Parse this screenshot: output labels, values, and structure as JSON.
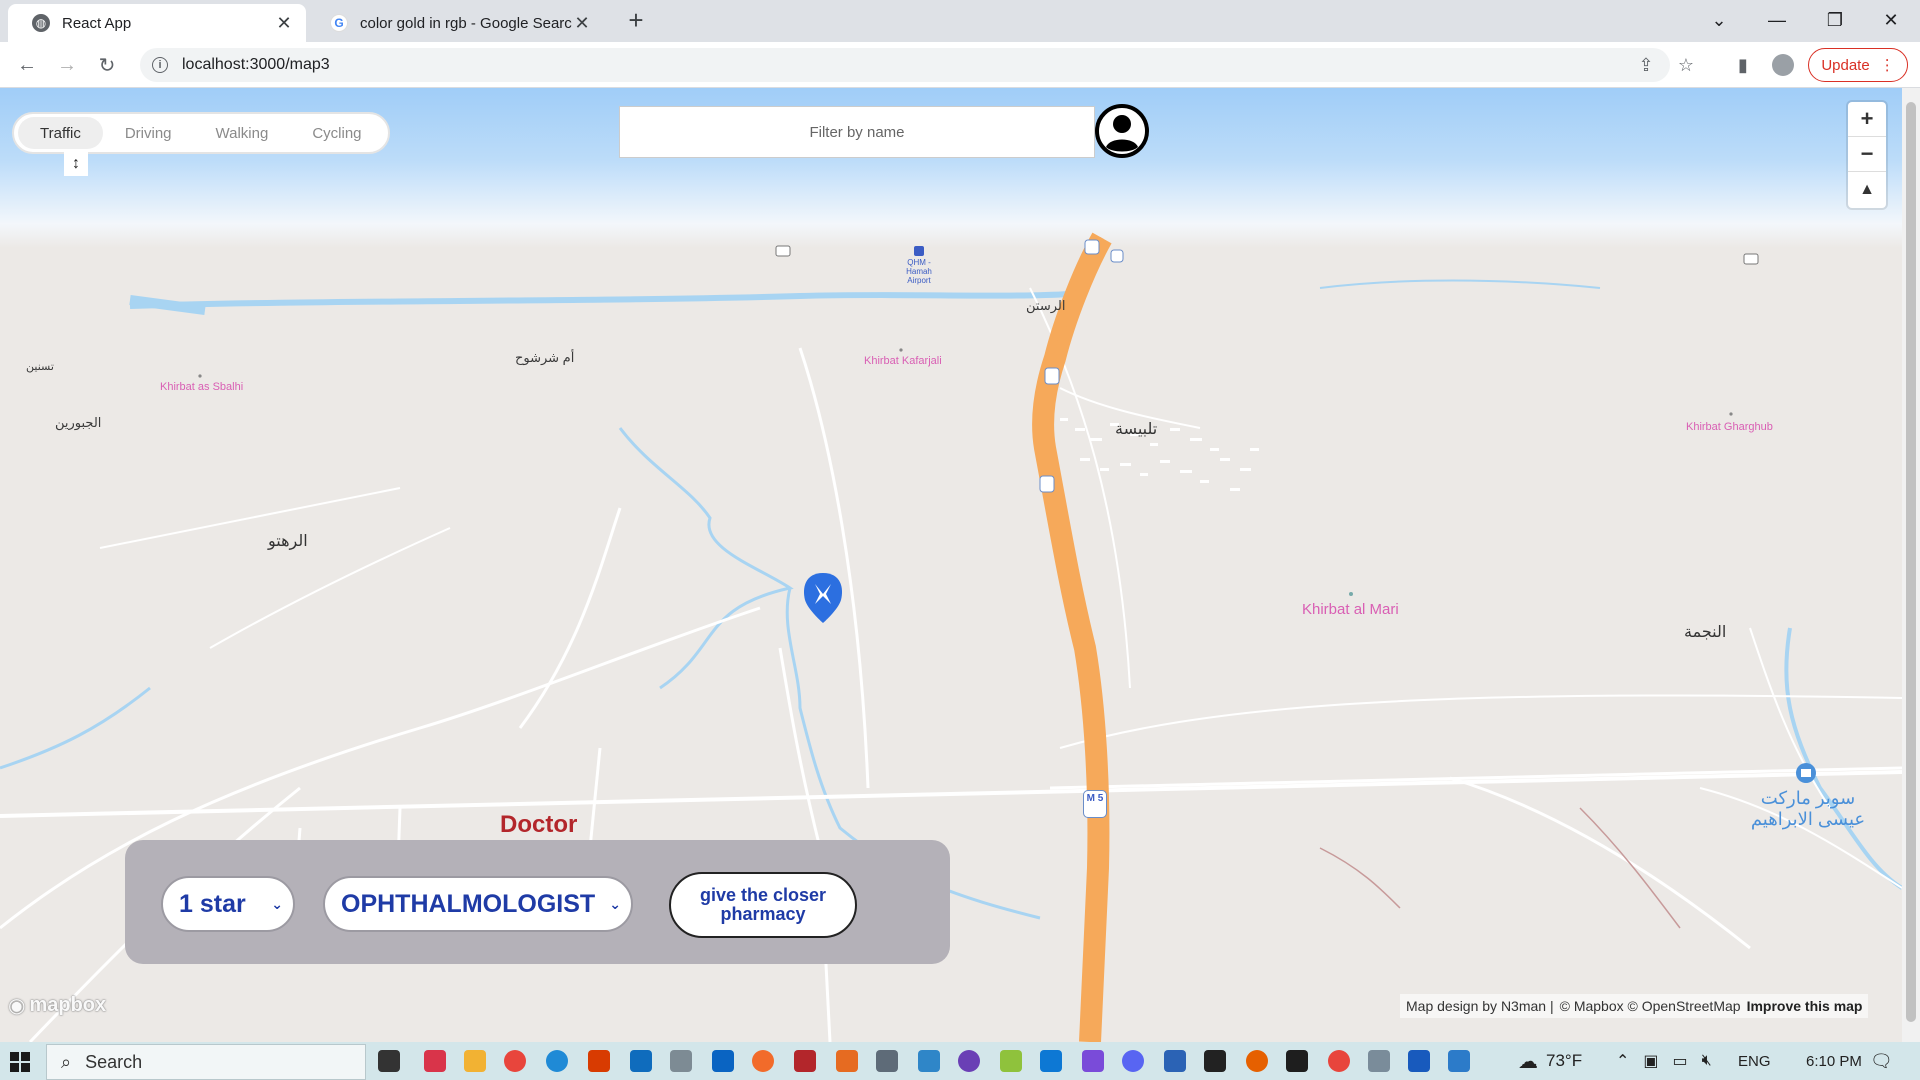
{
  "browser": {
    "tabs": [
      {
        "title": "React App",
        "favicon": "react-globe-icon"
      },
      {
        "title": "color gold in rgb - Google Search",
        "favicon": "google-icon"
      }
    ],
    "url": "localhost:3000/map3",
    "update_label": "Update"
  },
  "map": {
    "modes": [
      "Traffic",
      "Driving",
      "Walking",
      "Cycling"
    ],
    "selected_mode": "Traffic",
    "filter_placeholder": "Filter by name",
    "labels": {
      "airport": "QHM - Hamah Airport",
      "rastan": "الرستن",
      "kafarjali": "Khirbat Kafarjali",
      "um_sharshouh": "أم شرشوح",
      "tasnin": "تسنين",
      "sbalhi": "Khirbat as Sbalhi",
      "jabourin": "الجبورين",
      "talbisa": "تلبيسة",
      "gharghub": "Khirbat Gharghub",
      "rahtu": "الرهتو",
      "al_mari": "Khirbat al Mari",
      "najma": "النجمة",
      "supermarket": "سوبر ماركت عيسى الابراهيم",
      "highway": "M 5"
    },
    "doctor_label": "Doctor",
    "attribution": {
      "design": "Map design by N3man |",
      "copyright": "© Mapbox © OpenStreetMap",
      "improve": "Improve this map"
    },
    "logo": "mapbox"
  },
  "panel": {
    "rating": "1 star",
    "specialty": "OPHTHALMOLOGIST",
    "closer_button": "give the closer pharmacy"
  },
  "taskbar": {
    "search": "Search",
    "temperature": "73°F",
    "language": "ENG",
    "time": "6:10 PM"
  }
}
